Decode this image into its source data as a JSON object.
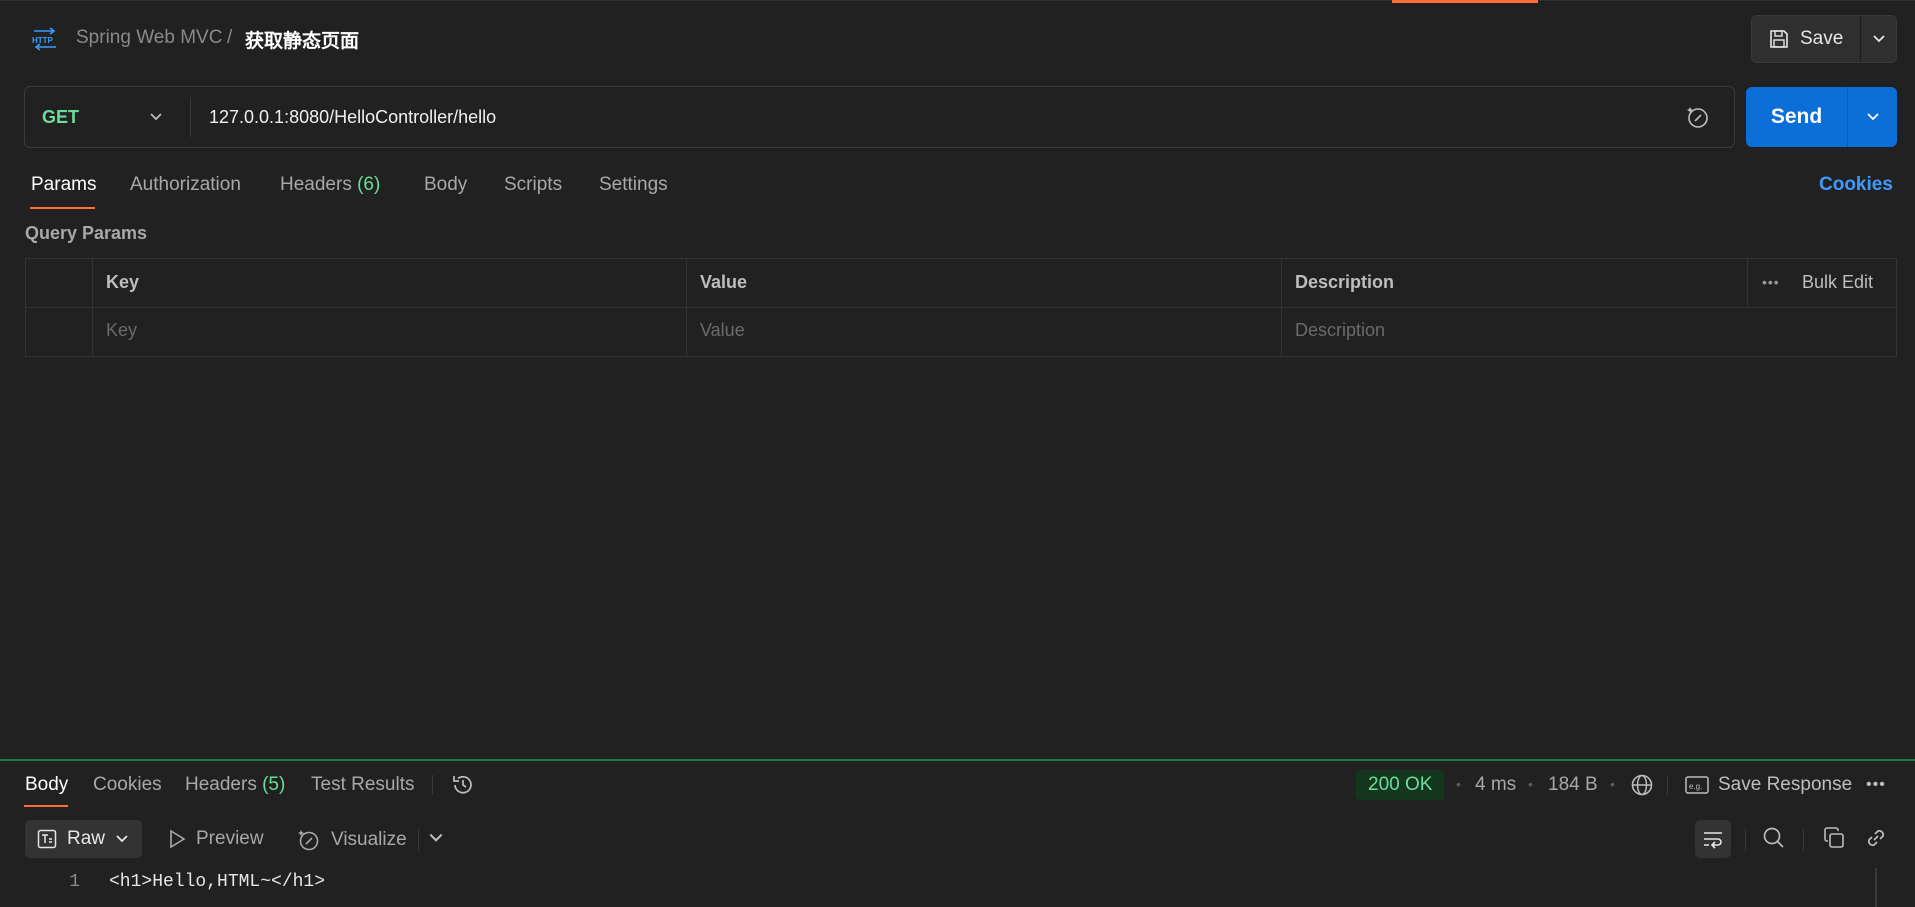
{
  "header": {
    "icon": "http-icon",
    "breadcrumb_parent": "Spring Web MVC",
    "breadcrumb_separator": "/",
    "title": "获取静态页面",
    "save_label": "Save"
  },
  "request": {
    "method": "GET",
    "url": "127.0.0.1:8080/HelloController/hello",
    "send_label": "Send",
    "tabs": [
      {
        "label": "Params",
        "active": true
      },
      {
        "label": "Authorization"
      },
      {
        "label": "Headers",
        "count": "(6)"
      },
      {
        "label": "Body"
      },
      {
        "label": "Scripts"
      },
      {
        "label": "Settings"
      }
    ],
    "cookies_label": "Cookies"
  },
  "query_params": {
    "section_label": "Query Params",
    "columns": [
      "Key",
      "Value",
      "Description"
    ],
    "bulk_edit_label": "Bulk Edit",
    "more_label": "•••",
    "placeholders": {
      "key": "Key",
      "value": "Value",
      "description": "Description"
    }
  },
  "response": {
    "tabs": [
      {
        "label": "Body",
        "active": true
      },
      {
        "label": "Cookies"
      },
      {
        "label": "Headers",
        "count": "(5)"
      },
      {
        "label": "Test Results"
      }
    ],
    "status": "200 OK",
    "time": "4 ms",
    "size": "184 B",
    "save_response_label": "Save Response",
    "more_label": "•••",
    "format": "Raw",
    "preview_label": "Preview",
    "visualize_label": "Visualize",
    "lines": [
      {
        "number": "1",
        "code": "<h1>Hello,HTML~</h1>"
      }
    ]
  },
  "colors": {
    "accent": "#ff6c37",
    "send": "#0c6fd8",
    "method_get": "#6bdd9a",
    "link": "#3d9bff",
    "status_ok_bg": "#14361f"
  }
}
